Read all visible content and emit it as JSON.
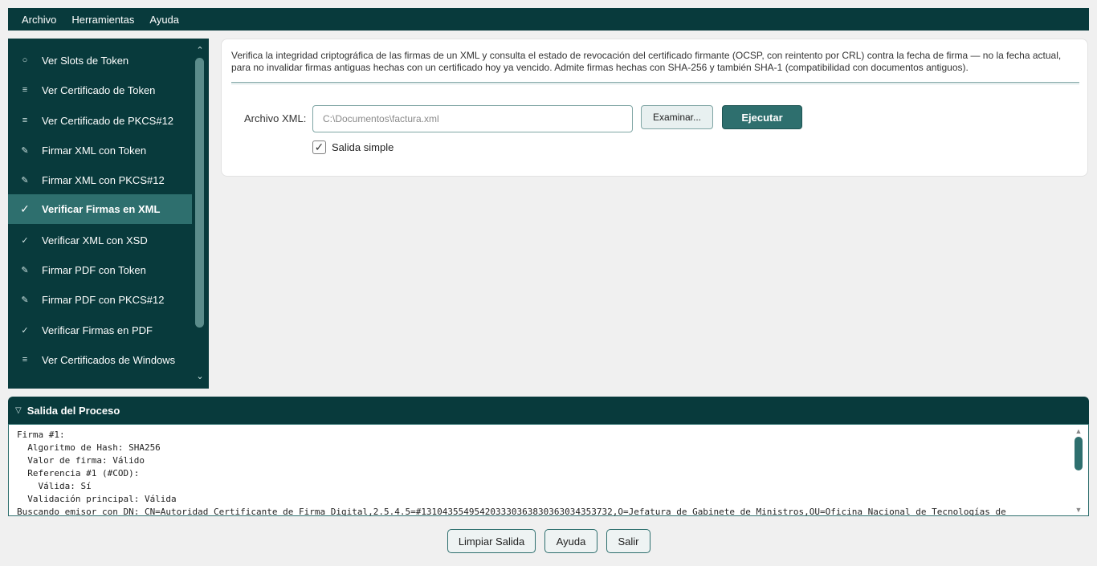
{
  "menubar": {
    "items": [
      {
        "label": "Archivo"
      },
      {
        "label": "Herramientas"
      },
      {
        "label": "Ayuda"
      }
    ]
  },
  "sidebar": {
    "items": [
      {
        "icon": "○",
        "icon_name": "circle-icon",
        "label": "Ver Slots de Token",
        "active": false
      },
      {
        "icon": "≡",
        "icon_name": "list-icon",
        "label": "Ver Certificado de Token",
        "active": false
      },
      {
        "icon": "≡",
        "icon_name": "list-icon",
        "label": "Ver Certificado de PKCS#12",
        "active": false
      },
      {
        "icon": "✎",
        "icon_name": "pen-icon",
        "label": "Firmar XML con Token",
        "active": false
      },
      {
        "icon": "✎",
        "icon_name": "pen-icon",
        "label": "Firmar XML con PKCS#12",
        "active": false
      },
      {
        "icon": "✓",
        "icon_name": "check-icon",
        "label": "Verificar Firmas en XML",
        "active": true
      },
      {
        "icon": "✓",
        "icon_name": "check-icon",
        "label": "Verificar XML con XSD",
        "active": false
      },
      {
        "icon": "✎",
        "icon_name": "pen-icon",
        "label": "Firmar PDF con Token",
        "active": false
      },
      {
        "icon": "✎",
        "icon_name": "pen-icon",
        "label": "Firmar PDF con PKCS#12",
        "active": false
      },
      {
        "icon": "✓",
        "icon_name": "check-icon",
        "label": "Verificar Firmas en PDF",
        "active": false
      },
      {
        "icon": "≡",
        "icon_name": "list-icon",
        "label": "Ver Certificados de Windows",
        "active": false
      }
    ],
    "scroll_up_icon": "⌃",
    "scroll_down_icon": "⌄"
  },
  "panel": {
    "description": "Verifica la integridad criptográfica de las firmas de un XML y consulta el estado de revocación del certificado firmante (OCSP, con reintento por CRL) contra la fecha de firma — no la fecha actual, para no invalidar firmas antiguas hechas con un certificado hoy ya vencido. Admite firmas hechas con SHA-256 y también SHA-1 (compatibilidad con documentos antiguos).",
    "xml_label": "Archivo XML:",
    "xml_placeholder": "C:\\Documentos\\factura.xml",
    "browse_label": "Examinar...",
    "run_label": "Ejecutar",
    "simple_output_label": "Salida simple",
    "simple_output_checked": true
  },
  "output": {
    "title": "Salida del Proceso",
    "collapse_icon": "▽",
    "text": "Firma #1:\n  Algoritmo de Hash: SHA256\n  Valor de firma: Válido\n  Referencia #1 (#COD):\n    Válida: Sí\n  Validación principal: Válida\nBuscando emisor con DN: CN=Autoridad Certificante de Firma Digital,2.5.4.5=#131043554954203330363830363034353732,O=Jefatura de Gabinete de Ministros,OU=Oficina Nacional de Tecnologías de"
  },
  "footer": {
    "clear_label": "Limpiar Salida",
    "help_label": "Ayuda",
    "exit_label": "Salir"
  },
  "colors": {
    "dark_teal": "#083a3c",
    "accent_teal": "#2e6f6e",
    "background": "#f0f0f0"
  }
}
